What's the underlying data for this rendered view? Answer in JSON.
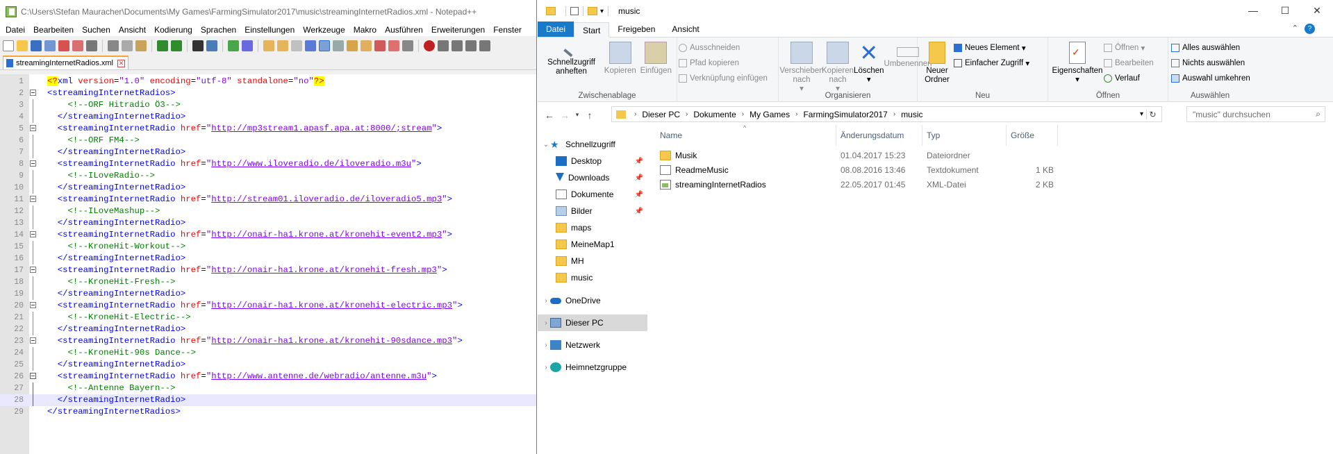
{
  "notepad": {
    "title": "C:\\Users\\Stefan Mauracher\\Documents\\My Games\\FarmingSimulator2017\\music\\streamingInternetRadios.xml - Notepad++",
    "menu": [
      "Datei",
      "Bearbeiten",
      "Suchen",
      "Ansicht",
      "Kodierung",
      "Sprachen",
      "Einstellungen",
      "Werkzeuge",
      "Makro",
      "Ausführen",
      "Erweiterungen",
      "Fenster"
    ],
    "tab_label": "streamingInternetRadios.xml",
    "lines": [
      {
        "n": "1",
        "type": "pi",
        "fold": "",
        "text": "<?xml version=\"1.0\" encoding=\"utf-8\" standalone=\"no\"?>"
      },
      {
        "n": "2",
        "type": "open_root",
        "fold": "box",
        "text": "<streamingInternetRadios>"
      },
      {
        "n": "3",
        "type": "comment2",
        "fold": "line",
        "text": "<!--ORF Hitradio Ö3-->"
      },
      {
        "n": "4",
        "type": "close1",
        "fold": "line",
        "text": "</streamingInternetRadio>"
      },
      {
        "n": "5",
        "type": "radio",
        "fold": "box",
        "href": "http://mp3stream1.apasf.apa.at:8000/;stream"
      },
      {
        "n": "6",
        "type": "comment2",
        "fold": "line",
        "text": "<!--ORF FM4-->"
      },
      {
        "n": "7",
        "type": "close1",
        "fold": "line",
        "text": "</streamingInternetRadio>"
      },
      {
        "n": "8",
        "type": "radio",
        "fold": "box",
        "href": "http://www.iloveradio.de/iloveradio.m3u"
      },
      {
        "n": "9",
        "type": "comment2",
        "fold": "line",
        "text": "<!--ILoveRadio-->"
      },
      {
        "n": "10",
        "type": "close1",
        "fold": "line",
        "text": "</streamingInternetRadio>"
      },
      {
        "n": "11",
        "type": "radio",
        "fold": "box",
        "href": "http://stream01.iloveradio.de/iloveradio5.mp3"
      },
      {
        "n": "12",
        "type": "comment2",
        "fold": "line",
        "text": "<!--ILoveMashup-->"
      },
      {
        "n": "13",
        "type": "close1",
        "fold": "line",
        "text": "</streamingInternetRadio>"
      },
      {
        "n": "14",
        "type": "radio",
        "fold": "box",
        "href": "http://onair-ha1.krone.at/kronehit-event2.mp3"
      },
      {
        "n": "15",
        "type": "comment2",
        "fold": "line",
        "text": "<!--KroneHit-Workout-->"
      },
      {
        "n": "16",
        "type": "close1",
        "fold": "line",
        "text": "</streamingInternetRadio>"
      },
      {
        "n": "17",
        "type": "radio",
        "fold": "box",
        "href": "http://onair-ha1.krone.at/kronehit-fresh.mp3"
      },
      {
        "n": "18",
        "type": "comment2",
        "fold": "line",
        "text": "<!--KroneHit-Fresh-->"
      },
      {
        "n": "19",
        "type": "close1",
        "fold": "line",
        "text": "</streamingInternetRadio>"
      },
      {
        "n": "20",
        "type": "radio",
        "fold": "box",
        "href": "http://onair-ha1.krone.at/kronehit-electric.mp3"
      },
      {
        "n": "21",
        "type": "comment2",
        "fold": "line",
        "text": "<!--KroneHit-Electric-->"
      },
      {
        "n": "22",
        "type": "close1",
        "fold": "line",
        "text": "</streamingInternetRadio>"
      },
      {
        "n": "23",
        "type": "radio",
        "fold": "box",
        "href": "http://onair-ha1.krone.at/kronehit-90sdance.mp3"
      },
      {
        "n": "24",
        "type": "comment2",
        "fold": "line",
        "text": "<!--KroneHit-90s Dance-->"
      },
      {
        "n": "25",
        "type": "close1",
        "fold": "line",
        "text": "</streamingInternetRadio>"
      },
      {
        "n": "26",
        "type": "radio",
        "fold": "redbox",
        "href": "http://www.antenne.de/webradio/antenne.m3u"
      },
      {
        "n": "27",
        "type": "comment2",
        "fold": "redline",
        "text": "<!--Antenne Bayern-->"
      },
      {
        "n": "28",
        "type": "close1",
        "fold": "redline",
        "text": "</streamingInternetRadio>",
        "current": true
      },
      {
        "n": "29",
        "type": "close_root",
        "fold": "",
        "text": "</streamingInternetRadios>"
      }
    ]
  },
  "explorer": {
    "title": "music",
    "tabs": {
      "file": "Datei",
      "start": "Start",
      "share": "Freigeben",
      "view": "Ansicht"
    },
    "ribbon": {
      "pin": "Schnellzugriff anheften",
      "copy": "Kopieren",
      "paste": "Einfügen",
      "cut": "Ausschneiden",
      "copy_path": "Pfad kopieren",
      "paste_link": "Verknüpfung einfügen",
      "clipboard": "Zwischenablage",
      "move": "Verschieben nach",
      "copy_to": "Kopieren nach",
      "delete": "Löschen",
      "rename": "Umbenennen",
      "organize": "Organisieren",
      "new_folder": "Neuer Ordner",
      "new_item": "Neues Element",
      "easy_access": "Einfacher Zugriff",
      "new": "Neu",
      "properties": "Eigenschaften",
      "open": "Öffnen",
      "edit": "Bearbeiten",
      "history": "Verlauf",
      "open_group": "Öffnen",
      "select_all": "Alles auswählen",
      "select_none": "Nichts auswählen",
      "invert": "Auswahl umkehren",
      "select": "Auswählen"
    },
    "address": [
      "Dieser PC",
      "Dokumente",
      "My Games",
      "FarmingSimulator2017",
      "music"
    ],
    "search_placeholder": "\"music\" durchsuchen",
    "nav": {
      "quick": "Schnellzugriff",
      "desktop": "Desktop",
      "downloads": "Downloads",
      "documents": "Dokumente",
      "pictures": "Bilder",
      "maps": "maps",
      "meinemap": "MeineMap1",
      "mh": "MH",
      "music": "music",
      "onedrive": "OneDrive",
      "thispc": "Dieser PC",
      "network": "Netzwerk",
      "homegroup": "Heimnetzgruppe"
    },
    "columns": {
      "name": "Name",
      "date": "Änderungsdatum",
      "type": "Typ",
      "size": "Größe"
    },
    "files": [
      {
        "name": "Musik",
        "date": "01.04.2017 15:23",
        "type": "Dateiordner",
        "size": "",
        "icon": "folder"
      },
      {
        "name": "ReadmeMusic",
        "date": "08.08.2016 13:46",
        "type": "Textdokument",
        "size": "1 KB",
        "icon": "txt"
      },
      {
        "name": "streamingInternetRadios",
        "date": "22.05.2017 01:45",
        "type": "XML-Datei",
        "size": "2 KB",
        "icon": "xml"
      }
    ]
  }
}
